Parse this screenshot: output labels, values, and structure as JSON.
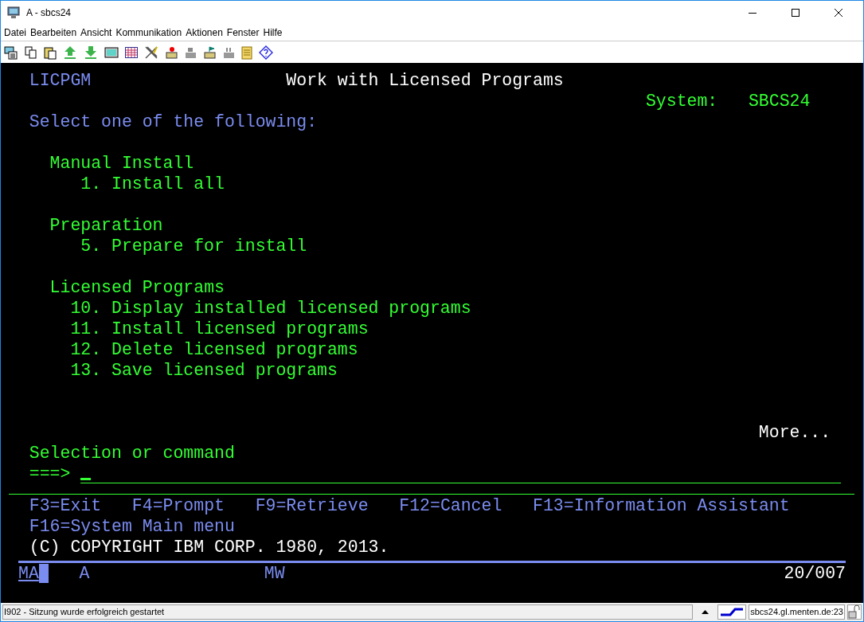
{
  "window": {
    "title": "A - sbcs24"
  },
  "menu": [
    "Datei",
    "Bearbeiten",
    "Ansicht",
    "Kommunikation",
    "Aktionen",
    "Fenster",
    "Hilfe"
  ],
  "screen": {
    "program": "LICPGM",
    "title": "Work with Licensed Programs",
    "system_label": "System:",
    "system_name": "SBCS24",
    "instruction": "Select one of the following:",
    "groups": [
      {
        "heading": "Manual Install",
        "options": [
          {
            "number": "1.",
            "label": "Install all"
          }
        ]
      },
      {
        "heading": "Preparation",
        "options": [
          {
            "number": "5.",
            "label": "Prepare for install"
          }
        ]
      },
      {
        "heading": "Licensed Programs",
        "options": [
          {
            "number": "10.",
            "label": "Display installed licensed programs"
          },
          {
            "number": "11.",
            "label": "Install licensed programs"
          },
          {
            "number": "12.",
            "label": "Delete licensed programs"
          },
          {
            "number": "13.",
            "label": "Save licensed programs"
          }
        ]
      }
    ],
    "more": "More...",
    "prompt": "Selection or command",
    "arrow": "===>",
    "function_keys": [
      "F3=Exit",
      "F4=Prompt",
      "F9=Retrieve",
      "F12=Cancel",
      "F13=Information Assistant",
      "F16=System Main menu"
    ],
    "copyright": "(C) COPYRIGHT IBM CORP. 1980, 2013."
  },
  "operator_info": {
    "indicators": [
      "MA",
      "A",
      "MW"
    ],
    "cursor_position": "20/007"
  },
  "status_bar": {
    "message": "I902 - Sitzung wurde erfolgreich gestartet",
    "host": "sbcs24.gl.menten.de:23"
  }
}
